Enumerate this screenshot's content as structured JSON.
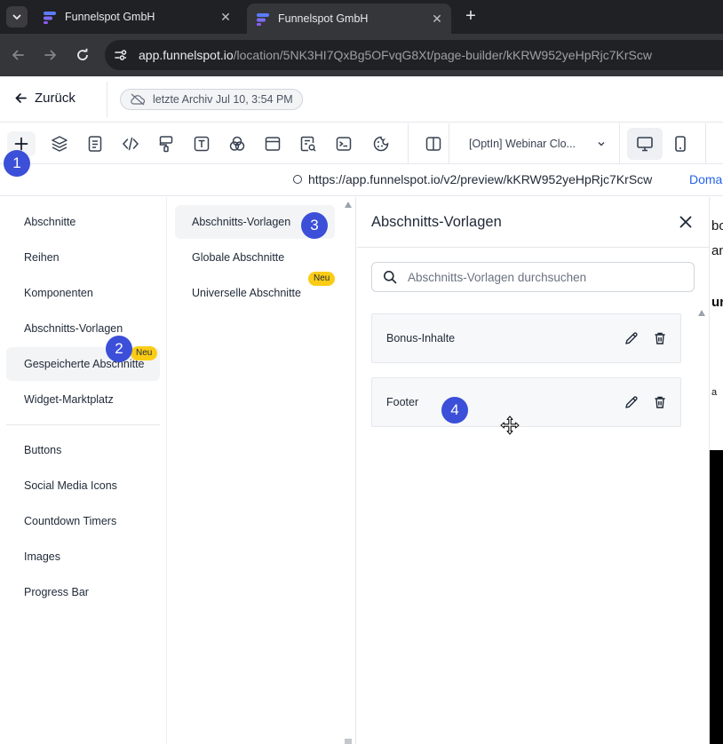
{
  "browser": {
    "tabs": [
      {
        "title": "Funnelspot GmbH",
        "active": false
      },
      {
        "title": "Funnelspot GmbH",
        "active": true
      }
    ],
    "url_domain": "app.funnelspot.io",
    "url_path": "/location/5NK3HI7QxBg5OFvqG8Xt/page-builder/kKRW952yeHpRjc7KrScw"
  },
  "app_header": {
    "back_label": "Zurück",
    "archive_label": "letzte Archiv Jul 10, 3:54 PM"
  },
  "toolbar": {
    "page_select": "[OptIn] Webinar Clo..."
  },
  "preview": {
    "url": "https://app.funnelspot.io/v2/preview/kKRW952yeHpRjc7KrScw",
    "domain_link": "Doma"
  },
  "left_menu": {
    "items": [
      {
        "label": "Abschnitte"
      },
      {
        "label": "Reihen"
      },
      {
        "label": "Komponenten"
      },
      {
        "label": "Abschnitts-Vorlagen"
      },
      {
        "label": "Gespeicherte Abschnitte",
        "badge": "Neu"
      },
      {
        "label": "Widget-Marktplatz"
      }
    ],
    "elements": [
      {
        "label": "Buttons"
      },
      {
        "label": "Social Media Icons"
      },
      {
        "label": "Countdown Timers"
      },
      {
        "label": "Images"
      },
      {
        "label": "Progress Bar"
      }
    ]
  },
  "mid_menu": {
    "items": [
      {
        "label": "Abschnitts-Vorlagen"
      },
      {
        "label": "Globale Abschnitte"
      },
      {
        "label": "Universelle Abschnitte",
        "badge": "Neu"
      }
    ]
  },
  "right_panel": {
    "title": "Abschnitts-Vorlagen",
    "search_placeholder": "Abschnitts-Vorlagen durchsuchen",
    "templates": [
      {
        "name": "Bonus-Inhalte"
      },
      {
        "name": "Footer"
      }
    ]
  },
  "edge_content": {
    "lines": [
      "bo",
      "an",
      "ur",
      "a"
    ]
  },
  "steps": [
    "1",
    "2",
    "3",
    "4"
  ],
  "colors": {
    "step_marker": "#3b4fd8",
    "badge": "#facc15",
    "link": "#2563eb"
  }
}
